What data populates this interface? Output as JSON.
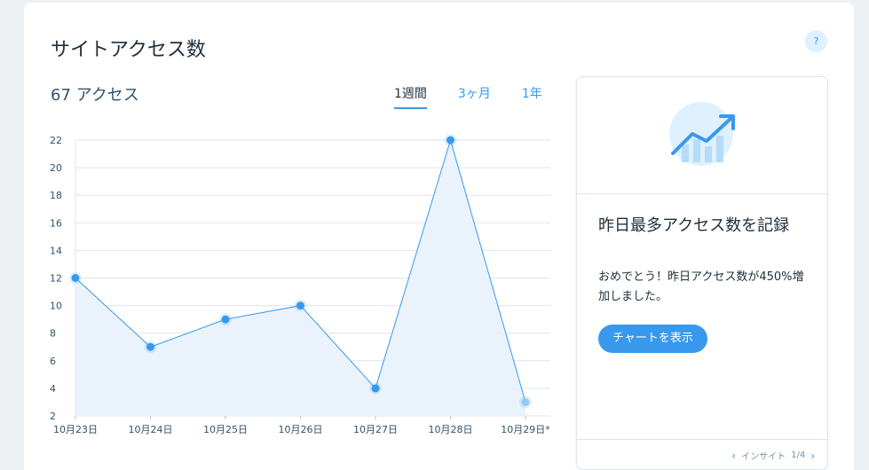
{
  "card": {
    "title": "サイトアクセス数",
    "help": "?"
  },
  "summary": {
    "count": "67 アクセス"
  },
  "tabs": [
    {
      "label": "1週間",
      "active": true
    },
    {
      "label": "3ヶ月",
      "active": false
    },
    {
      "label": "1年",
      "active": false
    }
  ],
  "colors": {
    "accent": "#3899ec",
    "fill": "#e8f2fc",
    "grid": "#dfe5eb"
  },
  "chart_data": {
    "type": "area",
    "categories": [
      "10月23日",
      "10月24日",
      "10月25日",
      "10月26日",
      "10月27日",
      "10月28日",
      "10月29日*"
    ],
    "values": [
      12,
      7,
      9,
      10,
      4,
      22,
      3
    ],
    "yticks": [
      2,
      4,
      6,
      8,
      10,
      12,
      14,
      16,
      18,
      20,
      22
    ],
    "ylim": [
      2,
      22
    ],
    "grid": true
  },
  "insight": {
    "illustration_icon": "trending-up-chart-icon",
    "title": "昨日最多アクセス数を記録",
    "body": "おめでとう！昨日アクセス数が450%増加しました。",
    "button": "チャートを表示",
    "nav_label": "インサイト",
    "page": "1/4"
  }
}
